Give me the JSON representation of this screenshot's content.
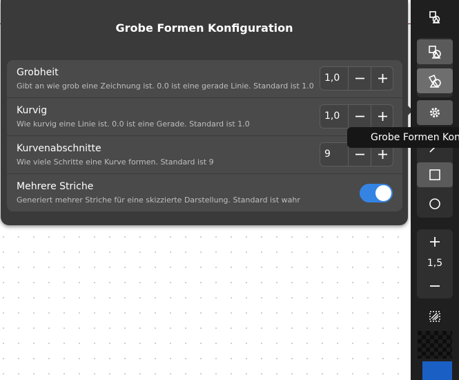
{
  "popover": {
    "title": "Grobe Formen Konfiguration",
    "rows": [
      {
        "title": "Grobheit",
        "subtitle": "Gibt an wie grob eine Zeichnung ist. 0.0 ist eine gerade Linie. Standard ist 1.0",
        "value": "1,0"
      },
      {
        "title": "Kurvig",
        "subtitle": "Wie kurvig eine Linie ist. 0.0 ist eine Gerade. Standard ist 1.0",
        "value": "1,0"
      },
      {
        "title": "Kurvenabschnitte",
        "subtitle": "Wie viele Schritte eine Kurve formen. Standard ist 9",
        "value": "9"
      },
      {
        "title": "Mehrere Striche",
        "subtitle": "Generiert mehrer Striche für eine skizzierte Darstellung. Standard ist wahr",
        "toggle_on": true
      }
    ]
  },
  "tooltip": {
    "text": "Grobe Formen Konfiguration"
  },
  "toolbar": {
    "stroke_width": "1,5",
    "colors": {
      "stroke": "#0d0d0d",
      "fill": "#1a5fc4",
      "accent": "#3584e4"
    }
  }
}
